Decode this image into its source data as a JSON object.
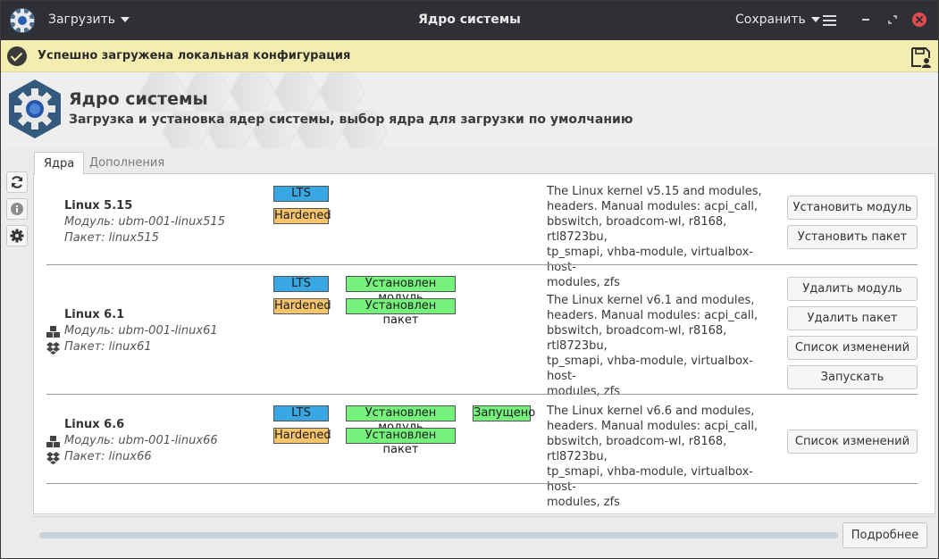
{
  "titlebar": {
    "load_menu": "Загрузить",
    "title": "Ядро системы",
    "save_menu": "Сохранить"
  },
  "notification": {
    "text": "Успешно загружена локальная конфигурация"
  },
  "header": {
    "title": "Ядро системы",
    "subtitle": "Загрузка и установка ядер системы, выбор ядра для загрузки по умолчанию"
  },
  "tabs": [
    "Ядра",
    "Дополнения"
  ],
  "kernels": [
    {
      "name": "Linux 5.15",
      "module": "Модуль: ubm-001-linux515",
      "package": "Пакет: linux515",
      "badges": [
        "LTS",
        "Hardened"
      ],
      "description": [
        "The Linux kernel v5.15 and modules,",
        "headers. Manual modules: acpi_call,",
        "bbswitch, broadcom-wl, r8168, rtl8723bu,",
        "tp_smapi, vhba-module, virtualbox-host-",
        "modules, zfs"
      ],
      "buttons": [
        "Установить модуль",
        "Установить пакет"
      ]
    },
    {
      "name": "Linux 6.1",
      "module": "Модуль: ubm-001-linux61",
      "package": "Пакет: linux61",
      "badges": [
        "LTS",
        "Hardened"
      ],
      "status": [
        "Установлен модуль",
        "Установлен пакет"
      ],
      "description": [
        "The Linux kernel v6.1 and modules,",
        "headers. Manual modules: acpi_call,",
        "bbswitch, broadcom-wl, r8168, rtl8723bu,",
        "tp_smapi, vhba-module, virtualbox-host-",
        "modules, zfs"
      ],
      "buttons": [
        "Удалить модуль",
        "Удалить пакет",
        "Список изменений",
        "Запускать"
      ]
    },
    {
      "name": "Linux 6.6",
      "module": "Модуль: ubm-001-linux66",
      "package": "Пакет: linux66",
      "badges": [
        "LTS",
        "Hardened"
      ],
      "status": [
        "Установлен модуль",
        "Установлен пакет"
      ],
      "running": "Запущено",
      "description": [
        "The Linux kernel v6.6 and modules,",
        "headers. Manual modules: acpi_call,",
        "bbswitch, broadcom-wl, r8168, rtl8723bu,",
        "tp_smapi, vhba-module, virtualbox-host-",
        "modules, zfs"
      ],
      "buttons": [
        "Список изменений"
      ]
    }
  ],
  "footer": {
    "more_button": "Подробнее"
  },
  "icons": {
    "app": "gear-icon",
    "refresh": "refresh-icon",
    "info": "info-icon",
    "settings": "gear-icon",
    "module": "cubes-icon",
    "package": "dropbox-icon",
    "save_profile": "save-profile-icon",
    "success": "check-circle-icon"
  },
  "colors": {
    "lts": "#38a7e4",
    "hardened": "#f6c46a",
    "status_green": "#74f27c",
    "notification_bg": "#f3edb0",
    "titlebar_bg": "#2f3035",
    "close_red": "#e14b4b"
  }
}
